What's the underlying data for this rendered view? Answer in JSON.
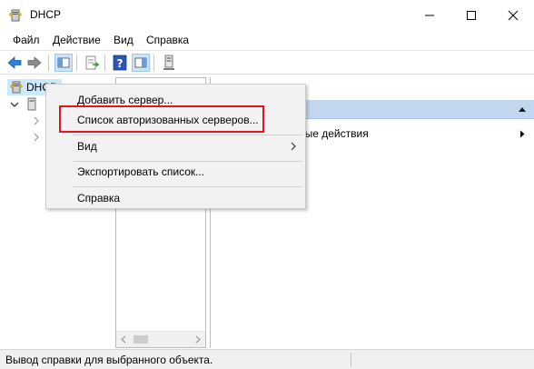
{
  "window": {
    "title": "DHCP",
    "icon": "dhcp-server-icon",
    "controls": [
      "minimize-icon",
      "maximize-icon",
      "close-icon"
    ]
  },
  "menubar": {
    "items": [
      {
        "label": "Файл"
      },
      {
        "label": "Действие"
      },
      {
        "label": "Вид"
      },
      {
        "label": "Справка"
      }
    ]
  },
  "toolbar": {
    "icons": [
      "back-arrow-icon",
      "forward-arrow-icon",
      "show-hide-console-tree-icon",
      "export-list-icon",
      "help-icon",
      "show-hide-action-pane-icon",
      "server-icon"
    ]
  },
  "tree": {
    "root": {
      "label": "DHCP",
      "icon": "dhcp-server-icon"
    },
    "expand_glyph": "chevron-down-icon",
    "collapse_glyph": "chevron-right-icon"
  },
  "actions_pane": {
    "sub_label": "ные действия"
  },
  "context_menu": {
    "items": [
      {
        "label": "Добавить сервер..."
      },
      {
        "label": "Список авторизованных серверов...",
        "highlighted": true
      },
      {
        "label": "Вид",
        "has_submenu": true
      },
      {
        "label": "Экспортировать список..."
      },
      {
        "label": "Справка"
      }
    ]
  },
  "statusbar": {
    "text": "Вывод справки для выбранного объекта."
  },
  "colors": {
    "selection": "#cce8ff",
    "actions_header": "#c2d7ef",
    "highlight_border": "#e3141b",
    "menu_background": "#f2f2f2"
  }
}
